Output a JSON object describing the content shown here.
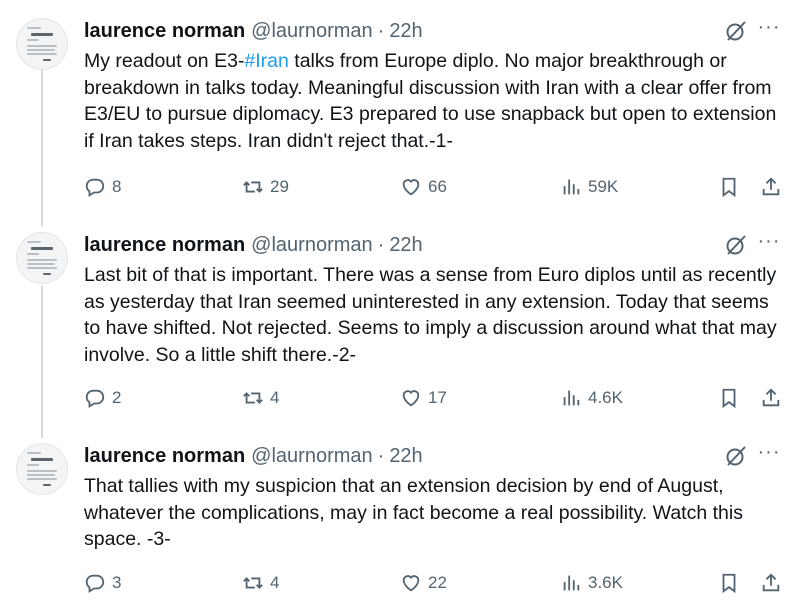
{
  "tweets": [
    {
      "author_name": "laurence norman",
      "handle": "@laurnorman",
      "separator": "·",
      "time": "22h",
      "text_before": "My readout on E3-",
      "hashtag": "#Iran",
      "text_after": " talks from Europe diplo. No major breakthrough or breakdown in talks today. Meaningful discussion with Iran with a clear offer from E3/EU to pursue diplomacy. E3 prepared to use snapback but open to extension if Iran takes steps. Iran didn't reject that.-1-",
      "replies": "8",
      "reposts": "29",
      "likes": "66",
      "views": "59K"
    },
    {
      "author_name": "laurence norman",
      "handle": "@laurnorman",
      "separator": "·",
      "time": "22h",
      "text_before": "Last bit of that is important. There was a sense from Euro diplos until as recently as yesterday that Iran seemed uninterested in any extension. Today that seems to have shifted. Not rejected. Seems to imply a discussion around what that may involve. So a little shift there.-2-",
      "hashtag": "",
      "text_after": "",
      "replies": "2",
      "reposts": "4",
      "likes": "17",
      "views": "4.6K"
    },
    {
      "author_name": "laurence norman",
      "handle": "@laurnorman",
      "separator": "·",
      "time": "22h",
      "text_before": "That tallies with my suspicion that an extension decision by end of August, whatever the complications, may in fact become a real possibility. Watch this space. -3-",
      "hashtag": "",
      "text_after": "",
      "replies": "3",
      "reposts": "4",
      "likes": "22",
      "views": "3.6K"
    }
  ],
  "more_label": "···",
  "icons": {
    "reply": "speech-bubble-icon",
    "repost": "repost-arrows-icon",
    "like": "heart-icon",
    "views": "bar-chart-icon",
    "bookmark": "bookmark-icon",
    "share": "share-upload-icon",
    "grok": "grok-slash-circle-icon"
  },
  "colors": {
    "text": "#0f1419",
    "secondary": "#536471",
    "hashtag": "#1d9bf0",
    "thread_line": "#cfd9de"
  }
}
